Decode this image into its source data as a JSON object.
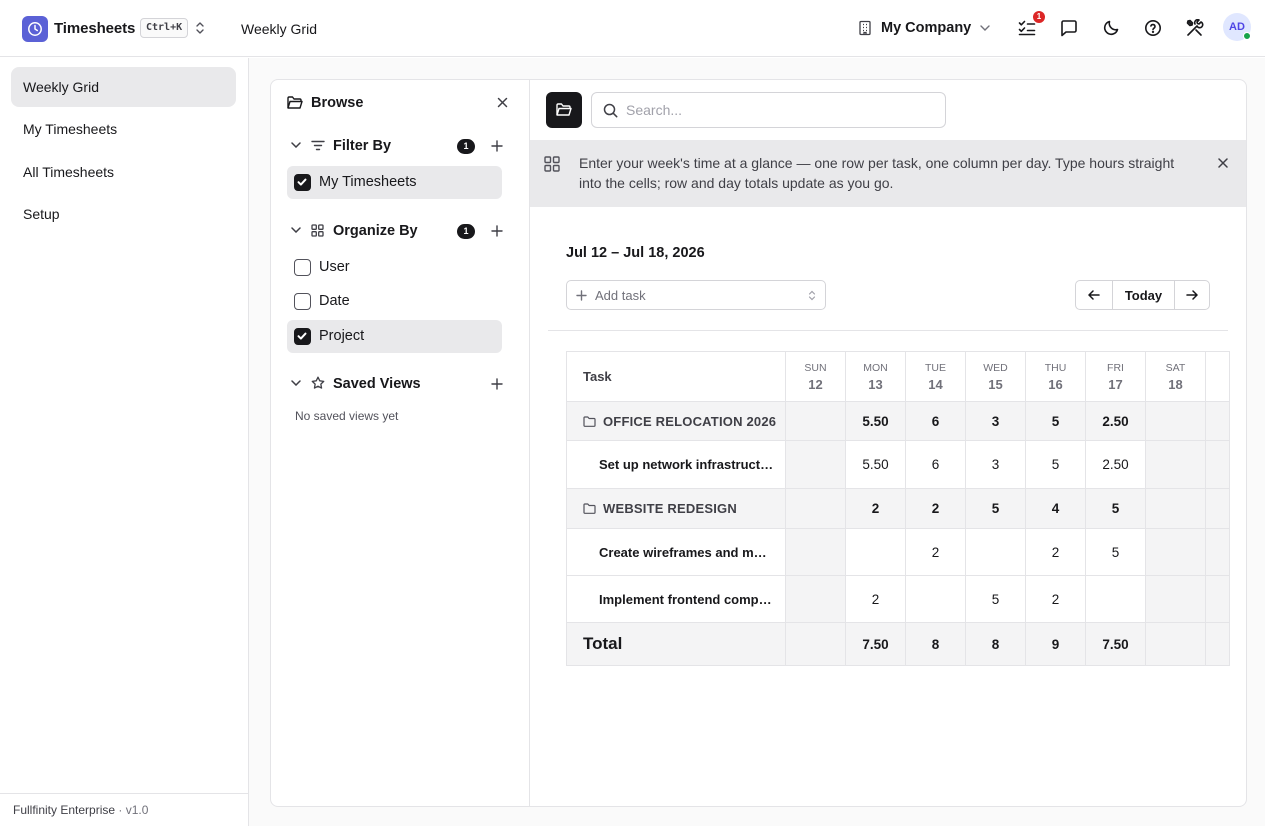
{
  "header": {
    "app_name": "Timesheets",
    "shortcut": "Ctrl+K",
    "page_title": "Weekly Grid",
    "company": "My Company",
    "notification_count": "1",
    "avatar_initials": "AD"
  },
  "sidebar": {
    "items": [
      {
        "label": "Weekly Grid",
        "active": true
      },
      {
        "label": "My Timesheets",
        "active": false
      },
      {
        "label": "All Timesheets",
        "active": false
      },
      {
        "label": "Setup",
        "active": false
      }
    ],
    "footer": {
      "product": "Fullfinity Enterprise",
      "separator": "·",
      "version": "v1.0"
    }
  },
  "browse": {
    "title": "Browse",
    "filter_by": {
      "title": "Filter By",
      "count": "1",
      "options": [
        {
          "label": "My Timesheets",
          "checked": true
        }
      ]
    },
    "organize_by": {
      "title": "Organize By",
      "count": "1",
      "options": [
        {
          "label": "User",
          "checked": false
        },
        {
          "label": "Date",
          "checked": false
        },
        {
          "label": "Project",
          "checked": true
        }
      ]
    },
    "saved_views": {
      "title": "Saved Views",
      "empty_text": "No saved views yet"
    }
  },
  "toolbar": {
    "search_placeholder": "Search..."
  },
  "banner": {
    "text": "Enter your week's time at a glance — one row per task, one column per day. Type hours straight into the cells; row and day totals update as you go."
  },
  "week": {
    "range": "Jul 12 – Jul 18, 2026",
    "add_task_placeholder": "Add task",
    "today_label": "Today"
  },
  "grid": {
    "task_header": "Task",
    "days": [
      {
        "name": "SUN",
        "num": "12"
      },
      {
        "name": "MON",
        "num": "13"
      },
      {
        "name": "TUE",
        "num": "14"
      },
      {
        "name": "WED",
        "num": "15"
      },
      {
        "name": "THU",
        "num": "16"
      },
      {
        "name": "FRI",
        "num": "17"
      },
      {
        "name": "SAT",
        "num": "18"
      }
    ],
    "rows": [
      {
        "type": "group",
        "name": "OFFICE RELOCATION 2026",
        "values": [
          "",
          "5.50",
          "6",
          "3",
          "5",
          "2.50",
          ""
        ]
      },
      {
        "type": "task",
        "name": "Set up network infrastructure",
        "values": [
          "",
          "5.50",
          "6",
          "3",
          "5",
          "2.50",
          ""
        ]
      },
      {
        "type": "group",
        "name": "WEBSITE REDESIGN",
        "values": [
          "",
          "2",
          "2",
          "5",
          "4",
          "5",
          ""
        ]
      },
      {
        "type": "task",
        "name": "Create wireframes and mockups",
        "values": [
          "",
          "",
          "2",
          "",
          "2",
          "5",
          ""
        ]
      },
      {
        "type": "task",
        "name": "Implement frontend components",
        "values": [
          "",
          "2",
          "",
          "5",
          "2",
          "",
          ""
        ]
      }
    ],
    "total": {
      "label": "Total",
      "values": [
        "",
        "7.50",
        "8",
        "8",
        "9",
        "7.50",
        ""
      ]
    }
  }
}
